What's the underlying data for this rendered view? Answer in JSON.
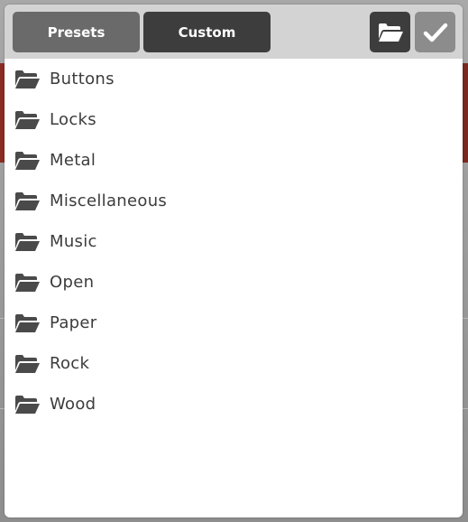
{
  "tabs": {
    "presets_label": "Presets",
    "custom_label": "Custom"
  },
  "toolbar": {
    "open_folder_icon": "folder-open-icon",
    "confirm_icon": "checkmark-icon"
  },
  "folders": [
    {
      "label": "Buttons",
      "icon": "folder-open-icon"
    },
    {
      "label": "Locks",
      "icon": "folder-open-icon"
    },
    {
      "label": "Metal",
      "icon": "folder-open-icon"
    },
    {
      "label": "Miscellaneous",
      "icon": "folder-open-icon"
    },
    {
      "label": "Music",
      "icon": "folder-open-icon"
    },
    {
      "label": "Open",
      "icon": "folder-open-icon"
    },
    {
      "label": "Paper",
      "icon": "folder-open-icon"
    },
    {
      "label": "Rock",
      "icon": "folder-open-icon"
    },
    {
      "label": "Wood",
      "icon": "folder-open-icon"
    }
  ],
  "colors": {
    "tab_inactive": "#6a6a6a",
    "tab_active": "#3d3d3d",
    "toolbar_bg": "#d3d3d3",
    "confirm_disabled": "#8c8c8c",
    "text": "#3c3c3c"
  }
}
